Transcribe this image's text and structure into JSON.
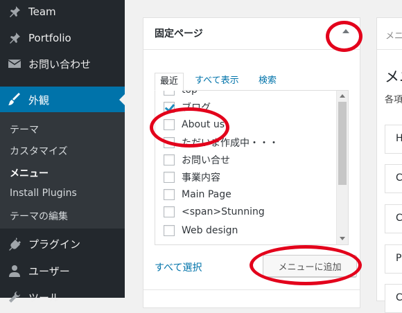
{
  "sidebar": {
    "items": [
      {
        "label": "Team",
        "icon": "pin-icon"
      },
      {
        "label": "Portfolio",
        "icon": "pin-icon"
      },
      {
        "label": "お問い合わせ",
        "icon": "mail-icon"
      },
      {
        "label": "外観",
        "icon": "brush-icon"
      },
      {
        "label": "プラグイン",
        "icon": "plug-icon"
      },
      {
        "label": "ユーザー",
        "icon": "user-icon"
      },
      {
        "label": "ツール",
        "icon": "wrench-icon"
      }
    ],
    "submenu": [
      "テーマ",
      "カスタマイズ",
      "メニュー",
      "Install Plugins",
      "テーマの編集"
    ],
    "active_color": "#0073aa"
  },
  "panel": {
    "title": "固定ページ",
    "tabs": [
      "最近",
      "すべて表示",
      "検索"
    ],
    "items": [
      {
        "label": "top",
        "checked": false
      },
      {
        "label": "ブログ",
        "checked": true
      },
      {
        "label": "About us",
        "checked": false
      },
      {
        "label": "ただいま作成中・・・",
        "checked": false
      },
      {
        "label": "お問い合せ",
        "checked": false
      },
      {
        "label": "事業内容",
        "checked": false
      },
      {
        "label": "Main Page",
        "checked": false
      },
      {
        "label": "<span>Stunning",
        "checked": false
      },
      {
        "label": "Web design",
        "checked": false
      }
    ],
    "select_all": "すべて選択",
    "add_button": "メニューに追加"
  },
  "right": {
    "head": "メニ",
    "title": "メニ",
    "desc": "各項",
    "boxes": [
      "H",
      "C",
      "C",
      "P",
      "C"
    ]
  },
  "annotation_color": "#e3001b"
}
